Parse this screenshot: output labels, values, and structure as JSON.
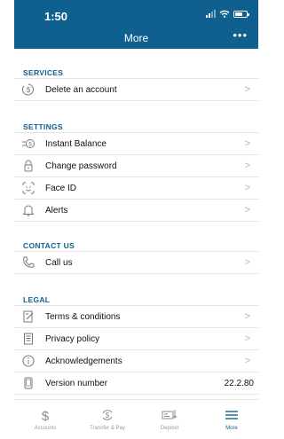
{
  "status_bar": {
    "time": "1:50"
  },
  "header": {
    "title": "More",
    "more_glyph": "•••"
  },
  "sections": {
    "services": {
      "header": "SERVICES",
      "items": [
        {
          "label": "Delete an account",
          "icon": "dollar-circle-icon",
          "chevron": ">"
        }
      ]
    },
    "settings": {
      "header": "SETTINGS",
      "items": [
        {
          "label": "Instant Balance",
          "icon": "instant-balance-icon",
          "chevron": ">"
        },
        {
          "label": "Change password",
          "icon": "lock-icon",
          "chevron": ">"
        },
        {
          "label": "Face ID",
          "icon": "face-id-icon",
          "chevron": ">"
        },
        {
          "label": "Alerts",
          "icon": "bell-icon",
          "chevron": ">"
        }
      ]
    },
    "contact": {
      "header": "CONTACT US",
      "items": [
        {
          "label": "Call us",
          "icon": "phone-icon",
          "chevron": ">"
        }
      ]
    },
    "legal": {
      "header": "LEGAL",
      "items": [
        {
          "label": "Terms & conditions",
          "icon": "pencil-document-icon",
          "chevron": ">"
        },
        {
          "label": "Privacy policy",
          "icon": "document-lines-icon",
          "chevron": ">"
        },
        {
          "label": "Acknowledgements",
          "icon": "info-icon",
          "chevron": ">"
        },
        {
          "label": "Version number",
          "icon": "phone-device-icon",
          "value": "22.2.80"
        }
      ]
    }
  },
  "tabbar": {
    "tabs": [
      {
        "label": "Accounts",
        "icon": "dollar-icon",
        "active": false
      },
      {
        "label": "Transfer & Pay",
        "icon": "dollar-arrows-icon",
        "active": false
      },
      {
        "label": "Deposit",
        "icon": "check-deposit-icon",
        "active": false
      },
      {
        "label": "More",
        "icon": "menu-icon",
        "active": true
      }
    ]
  },
  "colors": {
    "brand": "#10608f",
    "divider": "#e3e3e3",
    "chevron": "#b5b5b5"
  }
}
